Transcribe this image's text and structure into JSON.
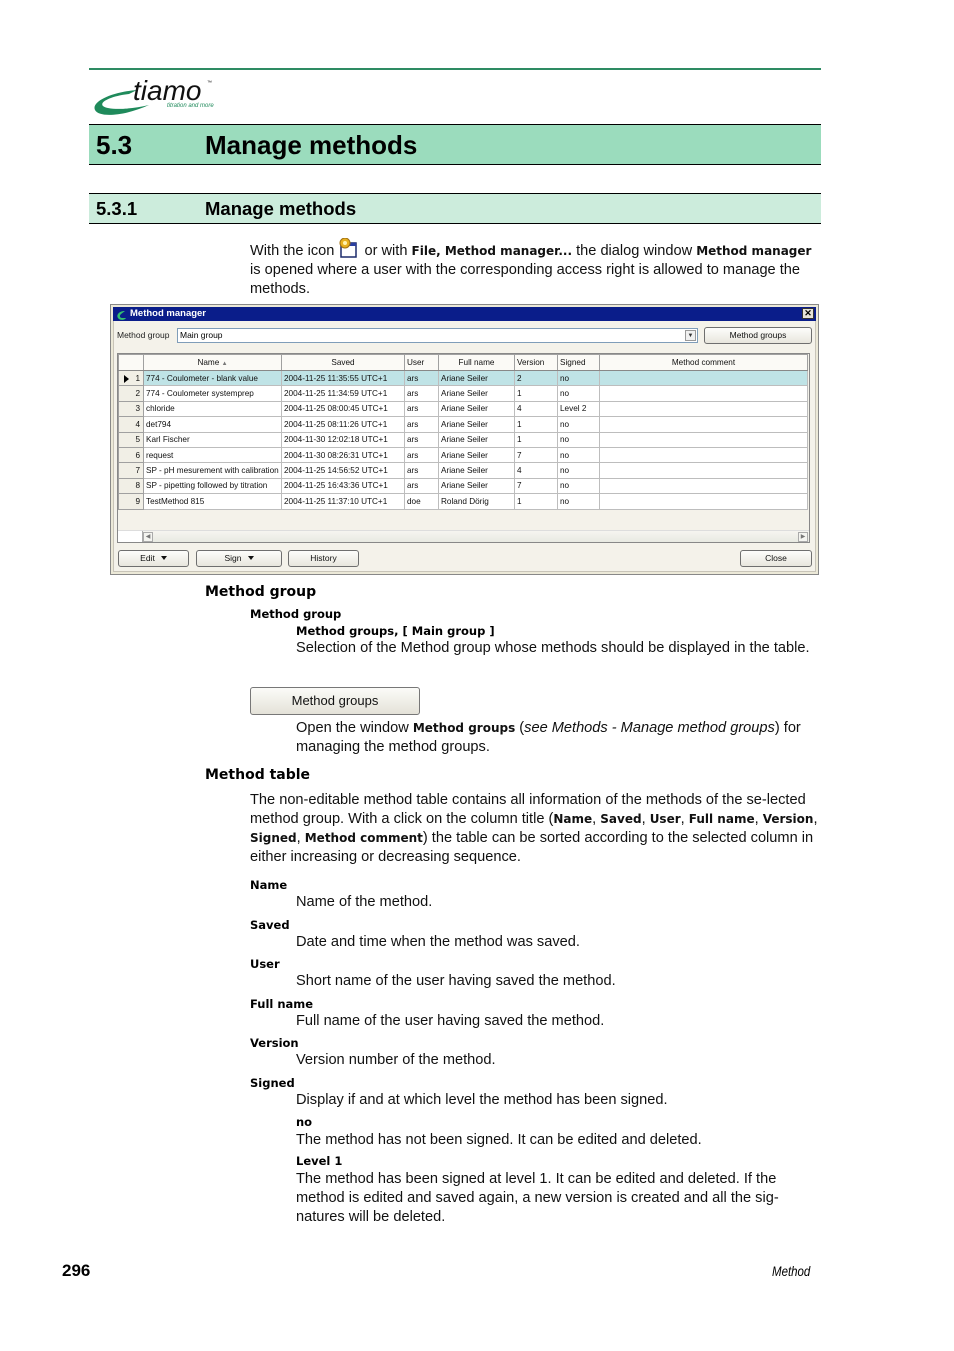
{
  "header": {
    "logo": {
      "brand": "tiamo",
      "trademark": "™",
      "tagline": "titration and more"
    },
    "section": {
      "number": "5.3",
      "title": "Manage methods"
    },
    "subsection": {
      "number": "5.3.1",
      "title": "Manage methods"
    }
  },
  "intro": {
    "part1": "With the icon ",
    "icon": "method-manager-icon",
    "part2": " or with ",
    "menu_path": "File, Method manager...",
    "part3": " the dialog window ",
    "dialog_name": "Method manager",
    "part4": " is opened where a user with the corresponding access right is allowed to manage the methods."
  },
  "dialog": {
    "title": "Method manager",
    "close_glyph": "✕",
    "method_group_label": "Method group",
    "method_group_value": "Main group",
    "method_groups_button": "Method groups",
    "table": {
      "sort_column": "Name",
      "sort_glyph": "▲",
      "columns": [
        "",
        "Name",
        "Saved",
        "User",
        "Full name",
        "Version",
        "Signed",
        "Method comment"
      ],
      "selected_row": 1,
      "rows": [
        {
          "n": "1",
          "name": "774 - Coulometer - blank value",
          "saved": "2004-11-25 11:35:55 UTC+1",
          "user": "ars",
          "full_name": "Ariane Seiler",
          "version": "2",
          "signed": "no",
          "comment": ""
        },
        {
          "n": "2",
          "name": "774 - Coulometer systemprep",
          "saved": "2004-11-25 11:34:59 UTC+1",
          "user": "ars",
          "full_name": "Ariane Seiler",
          "version": "1",
          "signed": "no",
          "comment": ""
        },
        {
          "n": "3",
          "name": "chloride",
          "saved": "2004-11-25 08:00:45 UTC+1",
          "user": "ars",
          "full_name": "Ariane Seiler",
          "version": "4",
          "signed": "Level 2",
          "comment": ""
        },
        {
          "n": "4",
          "name": "det794",
          "saved": "2004-11-25 08:11:26 UTC+1",
          "user": "ars",
          "full_name": "Ariane Seiler",
          "version": "1",
          "signed": "no",
          "comment": ""
        },
        {
          "n": "5",
          "name": "Karl Fischer",
          "saved": "2004-11-30 12:02:18 UTC+1",
          "user": "ars",
          "full_name": "Ariane Seiler",
          "version": "1",
          "signed": "no",
          "comment": ""
        },
        {
          "n": "6",
          "name": "request",
          "saved": "2004-11-30 08:26:31 UTC+1",
          "user": "ars",
          "full_name": "Ariane Seiler",
          "version": "7",
          "signed": "no",
          "comment": ""
        },
        {
          "n": "7",
          "name": "SP - pH mesurement with calibration",
          "saved": "2004-11-25 14:56:52 UTC+1",
          "user": "ars",
          "full_name": "Ariane Seiler",
          "version": "4",
          "signed": "no",
          "comment": ""
        },
        {
          "n": "8",
          "name": "SP - pipetting followed by titration",
          "saved": "2004-11-25 16:43:36 UTC+1",
          "user": "ars",
          "full_name": "Ariane Seiler",
          "version": "7",
          "signed": "no",
          "comment": ""
        },
        {
          "n": "9",
          "name": "TestMethod 815",
          "saved": "2004-11-25 11:37:10 UTC+1",
          "user": "doe",
          "full_name": "Roland Dörig",
          "version": "1",
          "signed": "no",
          "comment": ""
        }
      ]
    },
    "buttons": {
      "edit": "Edit",
      "sign": "Sign",
      "history": "History",
      "close": "Close"
    }
  },
  "method_group_section": {
    "heading": "Method group",
    "param_label": "Method group",
    "param_values": "Method groups, [ Main group ]",
    "param_desc": "Selection of the Method group whose methods should be displayed in the table.",
    "button_label": "Method groups",
    "button_desc_1": "Open the window ",
    "button_desc_bold": "Method groups",
    "button_desc_2": " (",
    "button_desc_italic": "see Methods - Manage method groups",
    "button_desc_3": ") for managing the method groups."
  },
  "method_table_section": {
    "heading": "Method table",
    "desc_1": "The non-editable method table contains all information of the methods of the se-lected method group. With a click on the column title (",
    "col_names": [
      "Name",
      "Saved",
      "User",
      "Full name",
      "Version",
      "Signed",
      "Method comment"
    ],
    "desc_2": ") the table can be sorted according to the selected column in either increasing or decreasing sequence.",
    "fields": [
      {
        "label": "Name",
        "desc": "Name of the method."
      },
      {
        "label": "Saved",
        "desc": "Date and time when the method was saved."
      },
      {
        "label": "User",
        "desc": "Short name of the user having saved the method."
      },
      {
        "label": "Full name",
        "desc": "Full name of the user having saved the method."
      },
      {
        "label": "Version",
        "desc": "Version number of the method."
      },
      {
        "label": "Signed",
        "desc": "Display if and at which level the method has been signed."
      }
    ],
    "signed_values": [
      {
        "label": "no",
        "desc": "The method has not been signed. It can be edited and deleted."
      },
      {
        "label": "Level 1",
        "desc": "The method has been signed at level 1. It can be edited and deleted. If the method is edited and saved again, a new version is created and all the sig-natures will be deleted."
      }
    ]
  },
  "footer": {
    "page_number": "296",
    "section_name": "Method"
  },
  "colors": {
    "rule": "#2e8b63",
    "h1_bg": "#9bdcbd",
    "h2_bg": "#ccecdc",
    "titlebar": "#0a1d8a",
    "selected_row": "#bfe3e6"
  }
}
